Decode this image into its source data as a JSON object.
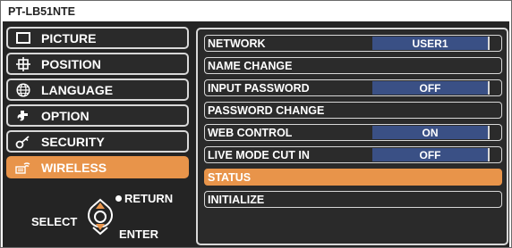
{
  "title": "PT-LB51NTE",
  "menu": [
    {
      "label": "PICTURE",
      "icon": "picture-icon"
    },
    {
      "label": "POSITION",
      "icon": "position-icon"
    },
    {
      "label": "LANGUAGE",
      "icon": "language-icon"
    },
    {
      "label": "OPTION",
      "icon": "option-icon"
    },
    {
      "label": "SECURITY",
      "icon": "security-icon"
    },
    {
      "label": "WIRELESS",
      "icon": "wireless-icon",
      "active": true
    }
  ],
  "nav": {
    "return_label": "RETURN",
    "select_label": "SELECT",
    "enter_label": "ENTER"
  },
  "rows": [
    {
      "label": "NETWORK",
      "value": "USER1"
    },
    {
      "label": "NAME CHANGE",
      "value": null
    },
    {
      "label": "INPUT PASSWORD",
      "value": "OFF"
    },
    {
      "label": "PASSWORD CHANGE",
      "value": null
    },
    {
      "label": "WEB CONTROL",
      "value": "ON"
    },
    {
      "label": "LIVE MODE CUT IN",
      "value": "OFF"
    },
    {
      "label": "STATUS",
      "value": null,
      "active": true
    },
    {
      "label": "INITIALIZE",
      "value": null
    }
  ],
  "colors": {
    "accent": "#e8944a",
    "value_bg": "#3a5085",
    "panel_bg": "#242424"
  }
}
